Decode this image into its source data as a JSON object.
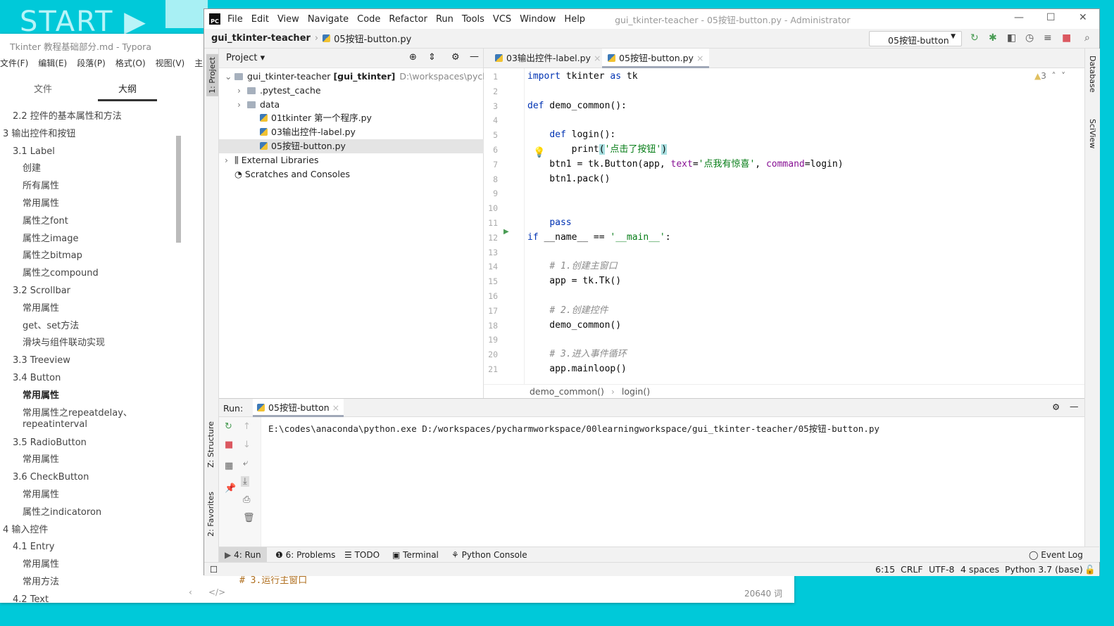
{
  "background": {
    "text": "START ▶"
  },
  "typora": {
    "title": "Tkinter 教程基础部分.md - Typora",
    "menu": [
      "文件(F)",
      "编辑(E)",
      "段落(P)",
      "格式(O)",
      "视图(V)",
      "主题(T)"
    ],
    "tabs": [
      "文件",
      "大纲"
    ],
    "outline": [
      {
        "t": "2.2 控件的基本属性和方法",
        "l": 2
      },
      {
        "t": "3 输出控件和按钮",
        "l": 1
      },
      {
        "t": "3.1 Label",
        "l": 2
      },
      {
        "t": "创建",
        "l": 3
      },
      {
        "t": "所有属性",
        "l": 3
      },
      {
        "t": "常用属性",
        "l": 3
      },
      {
        "t": "属性之font",
        "l": 3
      },
      {
        "t": "属性之image",
        "l": 3
      },
      {
        "t": "属性之bitmap",
        "l": 3
      },
      {
        "t": "属性之compound",
        "l": 3
      },
      {
        "t": "3.2 Scrollbar",
        "l": 2
      },
      {
        "t": "常用属性",
        "l": 3
      },
      {
        "t": "get、set方法",
        "l": 3
      },
      {
        "t": "滑块与组件联动实现",
        "l": 3
      },
      {
        "t": "3.3 Treeview",
        "l": 2
      },
      {
        "t": "3.4 Button",
        "l": 2
      },
      {
        "t": "常用属性",
        "l": 3,
        "b": true
      },
      {
        "t": "常用属性之repeatdelay、\nrepeatinterval",
        "l": 3,
        "two": true
      },
      {
        "t": "3.5 RadioButton",
        "l": 2
      },
      {
        "t": "常用属性",
        "l": 3
      },
      {
        "t": "3.6 CheckButton",
        "l": 2
      },
      {
        "t": "常用属性",
        "l": 3
      },
      {
        "t": "属性之indicatoron",
        "l": 3
      },
      {
        "t": "4 输入控件",
        "l": 1
      },
      {
        "t": "4.1 Entry",
        "l": 2
      },
      {
        "t": "常用属性",
        "l": 3
      },
      {
        "t": "常用方法",
        "l": 3
      },
      {
        "t": "4.2 Text",
        "l": 2
      }
    ],
    "code_peek": "# 3.运行主窗口",
    "source_toggle": "</>",
    "word_count": "20640 词"
  },
  "pycharm": {
    "menu": [
      "File",
      "Edit",
      "View",
      "Navigate",
      "Code",
      "Refactor",
      "Run",
      "Tools",
      "VCS",
      "Window",
      "Help"
    ],
    "window_title": "gui_tkinter-teacher - 05按钮-button.py - Administrator",
    "nav": {
      "project": "gui_tkinter-teacher",
      "file": "05按钮-button.py"
    },
    "run_config": "05按钮-button",
    "left_strip": [
      "1: Project",
      "Z: Structure",
      "2: Favorites"
    ],
    "right_strip": [
      "Database",
      "SciView"
    ],
    "project": {
      "title": "Project",
      "tree": [
        {
          "label": "gui_tkinter-teacher",
          "bold": "[gui_tkinter]",
          "path": "D:\\workspaces\\pycharm",
          "depth": 0,
          "type": "folder",
          "exp": "v"
        },
        {
          "label": ".pytest_cache",
          "depth": 1,
          "type": "folder",
          "exp": ">"
        },
        {
          "label": "data",
          "depth": 1,
          "type": "folder",
          "exp": ">"
        },
        {
          "label": "01tkinter 第一个程序.py",
          "depth": 2,
          "type": "py"
        },
        {
          "label": "03输出控件-label.py",
          "depth": 2,
          "type": "py"
        },
        {
          "label": "05按钮-button.py",
          "depth": 2,
          "type": "py",
          "sel": true
        },
        {
          "label": "External Libraries",
          "depth": 0,
          "type": "lib",
          "exp": ">"
        },
        {
          "label": "Scratches and Consoles",
          "depth": 0,
          "type": "scratch"
        }
      ]
    },
    "editor": {
      "tabs": [
        "03输出控件-label.py",
        "05按钮-button.py"
      ],
      "warnings": "3",
      "lines": [
        [
          [
            "kw",
            "import"
          ],
          [
            "t",
            " tkinter "
          ],
          [
            "kw",
            "as"
          ],
          [
            "t",
            " tk"
          ]
        ],
        [],
        [
          [
            "kw",
            "def"
          ],
          [
            "t",
            " demo_common():"
          ]
        ],
        [],
        [
          [
            "t",
            "    "
          ],
          [
            "kw",
            "def"
          ],
          [
            "t",
            " login():"
          ]
        ],
        [
          [
            "t",
            "        print"
          ],
          [
            "hl",
            "("
          ],
          [
            "str",
            "'点击了按钮'"
          ],
          [
            "hl",
            ")"
          ]
        ],
        [
          [
            "t",
            "    btn1 = tk.Button(app, "
          ],
          [
            "par",
            "text"
          ],
          [
            "t",
            "="
          ],
          [
            "str",
            "'点我有惊喜'"
          ],
          [
            "t",
            ", "
          ],
          [
            "par",
            "command"
          ],
          [
            "t",
            "=login)"
          ]
        ],
        [
          [
            "t",
            "    btn1.pack()"
          ]
        ],
        [],
        [],
        [
          [
            "t",
            "    "
          ],
          [
            "kw",
            "pass"
          ]
        ],
        [
          [
            "kw",
            "if"
          ],
          [
            "t",
            " __name__ == "
          ],
          [
            "str",
            "'__main__'"
          ],
          [
            "t",
            ":"
          ]
        ],
        [],
        [
          [
            "t",
            "    "
          ],
          [
            "cm",
            "# 1.创建主窗口"
          ]
        ],
        [
          [
            "t",
            "    app = tk.Tk()"
          ]
        ],
        [],
        [
          [
            "t",
            "    "
          ],
          [
            "cm",
            "# 2.创建控件"
          ]
        ],
        [
          [
            "t",
            "    demo_common()"
          ]
        ],
        [],
        [
          [
            "t",
            "    "
          ],
          [
            "cm",
            "# 3.进入事件循环"
          ]
        ],
        [
          [
            "t",
            "    app.mainloop()"
          ]
        ]
      ],
      "breadcrumb": [
        "demo_common()",
        "login()"
      ]
    },
    "run": {
      "label": "Run:",
      "tab": "05按钮-button",
      "output": "E:\\codes\\anaconda\\python.exe D:/workspaces/pycharmworkspace/00learningworkspace/gui_tkinter-teacher/05按钮-button.py"
    },
    "bottom_tabs": [
      "4: Run",
      "6: Problems",
      "TODO",
      "Terminal",
      "Python Console"
    ],
    "event_log": "Event Log",
    "status": {
      "position": "6:15",
      "line_sep": "CRLF",
      "encoding": "UTF-8",
      "indent": "4 spaces",
      "interpreter": "Python 3.7 (base)"
    }
  },
  "colors": {
    "desktop": "#00c9d9",
    "keyword": "#0033b3",
    "string": "#067d17",
    "param": "#871094",
    "comment": "#8c8c8c",
    "run_green": "#499c54",
    "stop_red": "#db5860"
  }
}
